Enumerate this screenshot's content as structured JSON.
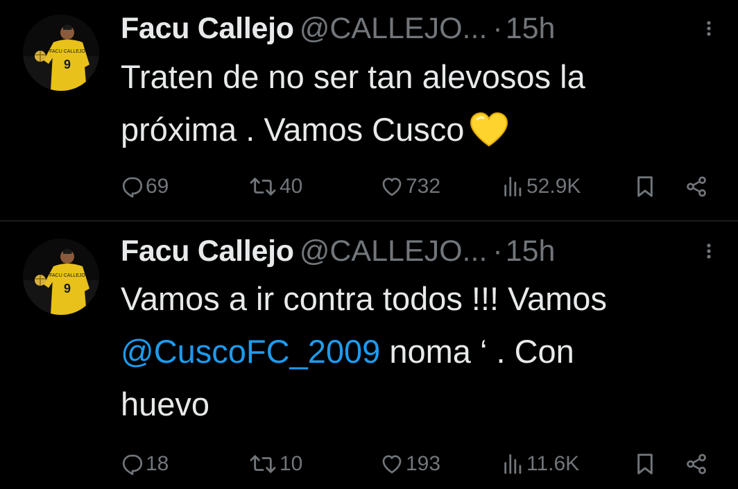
{
  "colors": {
    "background": "#000000",
    "text": "#e7e9ea",
    "muted": "#71767b",
    "link": "#1d9bf0",
    "divider": "#2f3336",
    "heart_emoji": "#ffd32e",
    "jersey": "#e8c21a"
  },
  "tweets": [
    {
      "author": {
        "name": "Facu Callejo",
        "handle": "@CALLEJO...",
        "avatar_icon": "avatar-player-yellow-jersey"
      },
      "separator": "·",
      "time": "15h",
      "more_icon": "more-vertical-icon",
      "text": {
        "line1": "Traten de no ser tan alevosos la",
        "line2": "próxima . Vamos Cusco",
        "emoji": "yellow-heart-emoji"
      },
      "stats": {
        "replies": "69",
        "retweets": "40",
        "likes": "732",
        "views": "52.9K"
      }
    },
    {
      "author": {
        "name": "Facu Callejo",
        "handle": "@CALLEJO...",
        "avatar_icon": "avatar-player-yellow-jersey"
      },
      "separator": "·",
      "time": "15h",
      "more_icon": "more-vertical-icon",
      "text": {
        "line1": "Vamos a ir contra todos !!! Vamos",
        "mention": "@CuscoFC_2009",
        "line2_rest": " noma ‘ . Con",
        "line3": "huevo"
      },
      "stats": {
        "replies": "18",
        "retweets": "10",
        "likes": "193",
        "views": "11.6K"
      }
    }
  ]
}
